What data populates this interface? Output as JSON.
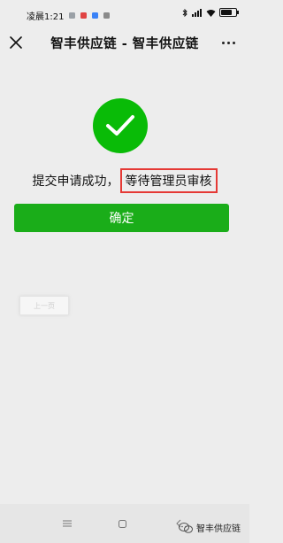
{
  "status_bar": {
    "time": "凌晨1:21"
  },
  "navbar": {
    "title": "智丰供应链 - 智丰供应链"
  },
  "message": {
    "prefix": "提交申请成功，",
    "highlight": "等待管理员审核"
  },
  "confirm_button": {
    "label": "确定"
  },
  "ghost_tag": {
    "label": "上一页"
  },
  "watermark": {
    "text": "智丰供应链"
  },
  "colors": {
    "success_green": "#09bb07",
    "button_green": "#1aad19",
    "highlight_red": "#e53935",
    "background": "#ededed"
  }
}
